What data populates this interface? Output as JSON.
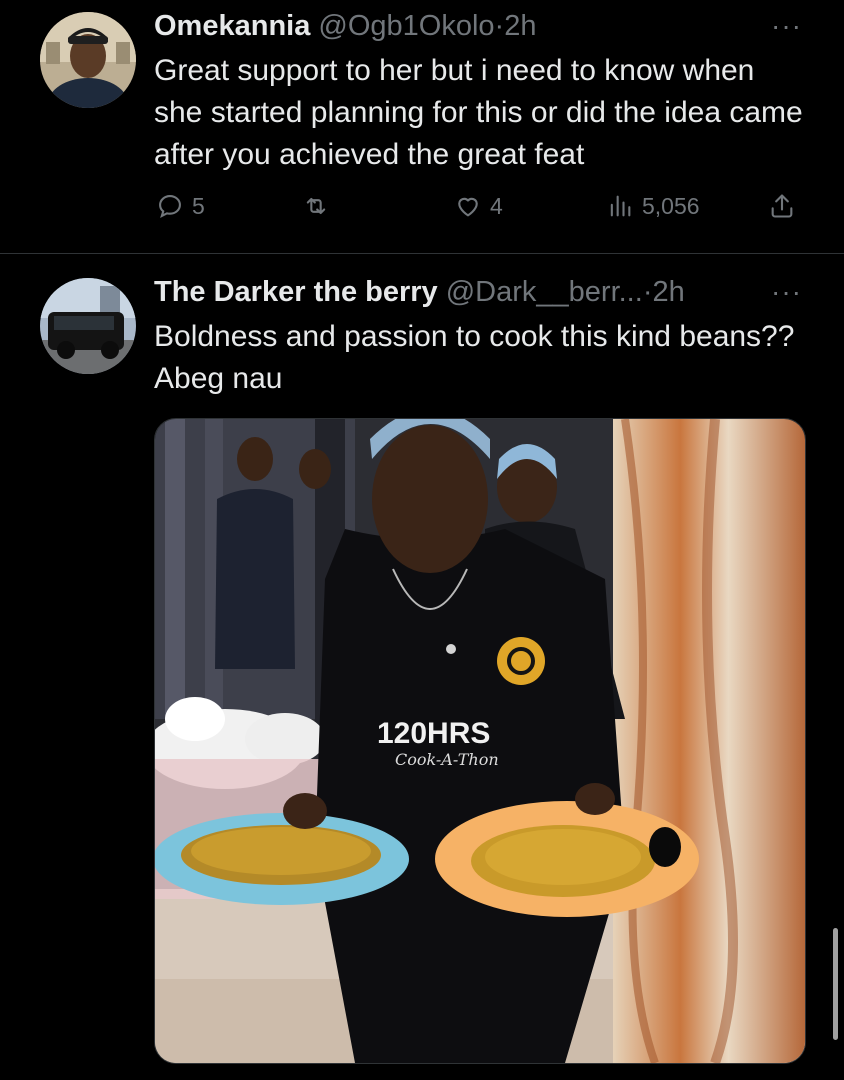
{
  "tweets": [
    {
      "display_name": "Omekannia",
      "handle": "@Ogb1Okolo",
      "separator": "·",
      "time": "2h",
      "text": "Great support to her but i need to know when she started planning for this or did the idea came after you achieved the great feat",
      "replies": "5",
      "likes": "4",
      "views": "5,056",
      "more": "···"
    },
    {
      "display_name": "The Darker the berry",
      "handle": "@Dark__berr...",
      "separator": "·",
      "time": "2h",
      "text": "Boldness and passion to cook this kind beans?? Abeg nau",
      "more": "···",
      "photo": {
        "shirt_title": "120HRS",
        "shirt_subtitle": "Cook-A-Thon"
      }
    }
  ],
  "colors": {
    "background": "#000000",
    "text": "#e7e9ea",
    "secondary": "#71767b",
    "divider": "#2f3336"
  }
}
